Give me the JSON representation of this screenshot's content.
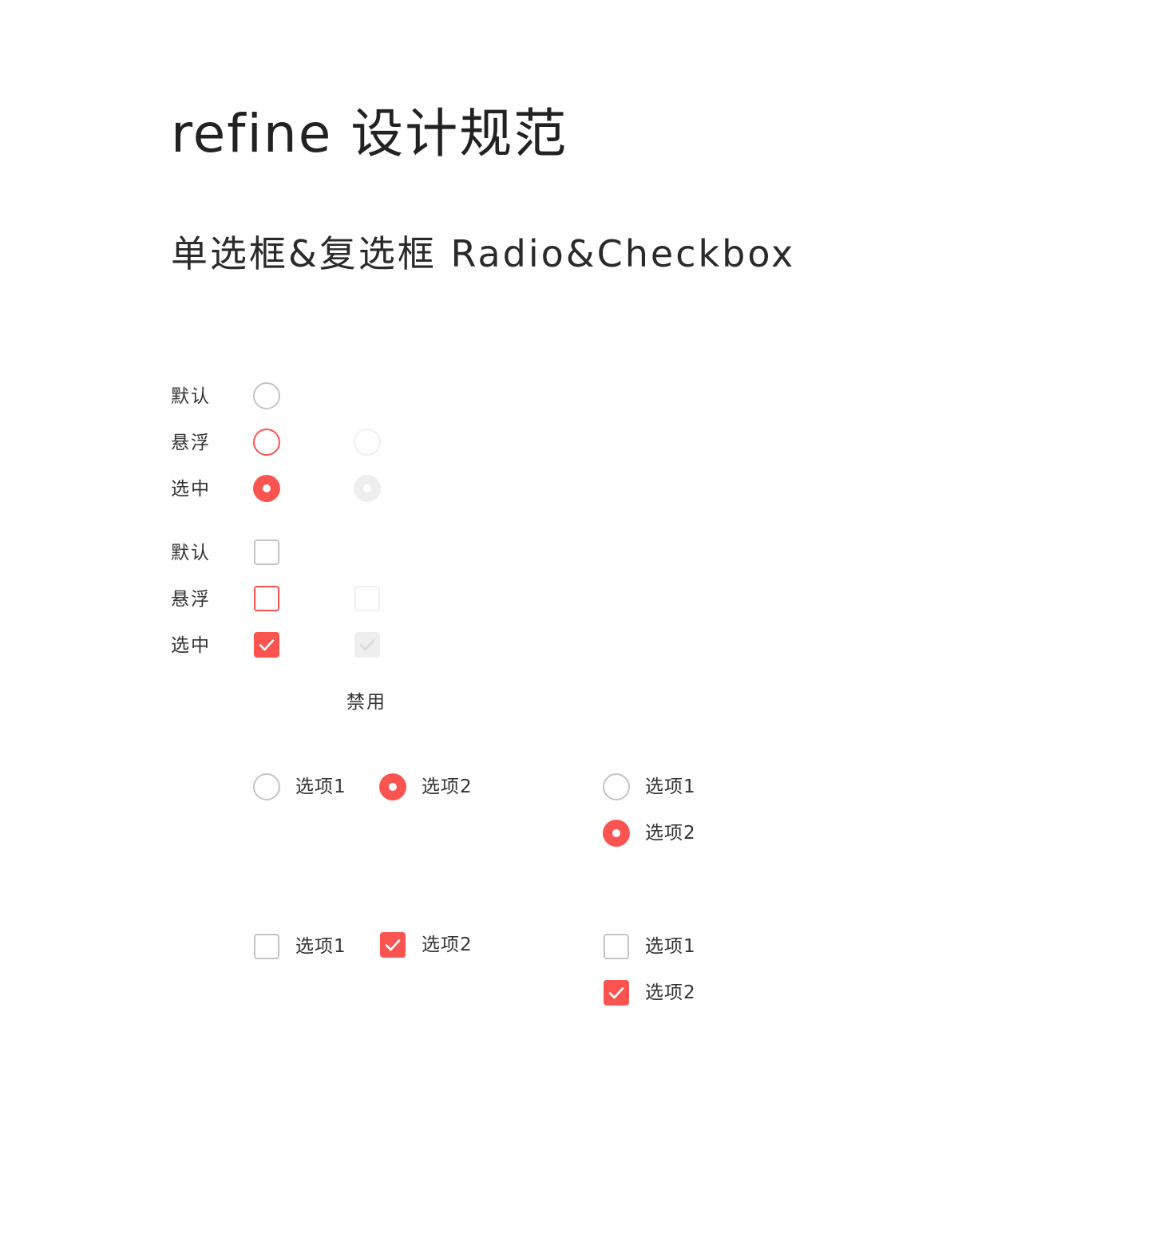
{
  "header": {
    "title": "refine 设计规范",
    "subtitle": "单选框&复选框 Radio&Checkbox"
  },
  "colors": {
    "accent": "#fa5451",
    "border_default": "#c4c4c4",
    "disabled_fill": "#eeeeee",
    "disabled_border": "#f0f0f0",
    "text": "#333333"
  },
  "states": {
    "radio": {
      "default_label": "默认",
      "hover_label": "悬浮",
      "checked_label": "选中"
    },
    "checkbox": {
      "default_label": "默认",
      "hover_label": "悬浮",
      "checked_label": "选中"
    },
    "disabled_label": "禁用"
  },
  "examples": {
    "radio_horizontal": [
      {
        "label": "选项1",
        "checked": false
      },
      {
        "label": "选项2",
        "checked": true
      }
    ],
    "radio_vertical": [
      {
        "label": "选项1",
        "checked": false
      },
      {
        "label": "选项2",
        "checked": true
      }
    ],
    "checkbox_horizontal": [
      {
        "label": "选项1",
        "checked": false
      },
      {
        "label": "选项2",
        "checked": true
      }
    ],
    "checkbox_vertical": [
      {
        "label": "选项1",
        "checked": false
      },
      {
        "label": "选项2",
        "checked": true
      }
    ]
  }
}
